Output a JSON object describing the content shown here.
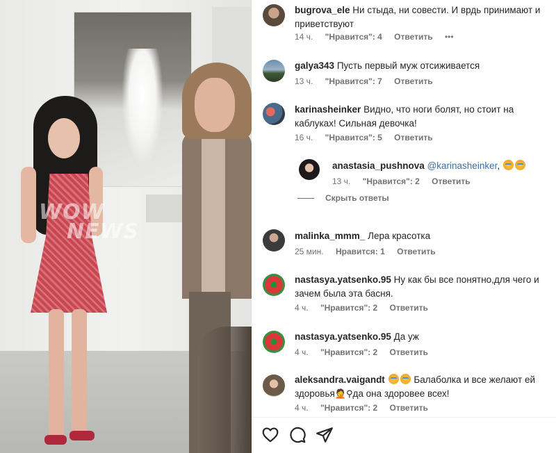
{
  "photo": {
    "watermark_line1": "WOW",
    "watermark_line2": "NEWS"
  },
  "comments": [
    {
      "username": "bugrova_ele",
      "text": "Ни стыда, ни совести. И врдь принимают и приветствуют",
      "time": "14 ч.",
      "likes": "\"Нравится\": 4",
      "reply": "Ответить",
      "more": "•••"
    },
    {
      "username": "galya343",
      "text": "Пусть первый муж отсиживается",
      "time": "13 ч.",
      "likes": "\"Нравится\": 7",
      "reply": "Ответить"
    },
    {
      "username": "karinasheinker",
      "text": "Видно, что ноги болят, но стоит на каблуках! Сильная девочка!",
      "time": "16 ч.",
      "likes": "\"Нравится\": 5",
      "reply": "Ответить"
    },
    {
      "username": "anastasia_pushnova",
      "mention": "@karinasheinker",
      "text": ",",
      "time": "13 ч.",
      "likes": "\"Нравится\": 2",
      "reply": "Ответить"
    },
    {
      "username": "malinka_mmm_",
      "text": "Лера красотка",
      "time": "25 мин.",
      "likes": "Нравится: 1",
      "reply": "Ответить"
    },
    {
      "username": "nastasya.yatsenko.95",
      "text": "Ну как бы все понятно,для чего и зачем была эта басня.",
      "time": "4 ч.",
      "likes": "\"Нравится\": 2",
      "reply": "Ответить"
    },
    {
      "username": "nastasya.yatsenko.95",
      "text": "Да уж",
      "time": "4 ч.",
      "likes": "\"Нравится\": 2",
      "reply": "Ответить"
    },
    {
      "username": "aleksandra.vaigandt",
      "text_part1": "Балаболка и все желают ей здоровья",
      "text_part2": "да она здоровее всех!",
      "time": "4 ч.",
      "likes": "\"Нравится\": 2",
      "reply": "Ответить"
    }
  ],
  "hide_replies": "Скрыть ответы",
  "icons": {
    "like": "heart-icon",
    "comment": "comment-icon",
    "share": "paper-plane-icon",
    "emoji": "laughing-tears-emoji",
    "person_emoji": "person-facepalming-emoji",
    "pin_emoji": "location-pin-emoji"
  },
  "colors": {
    "username": "#262626",
    "meta": "#737373",
    "mention": "#3d6fa8"
  }
}
